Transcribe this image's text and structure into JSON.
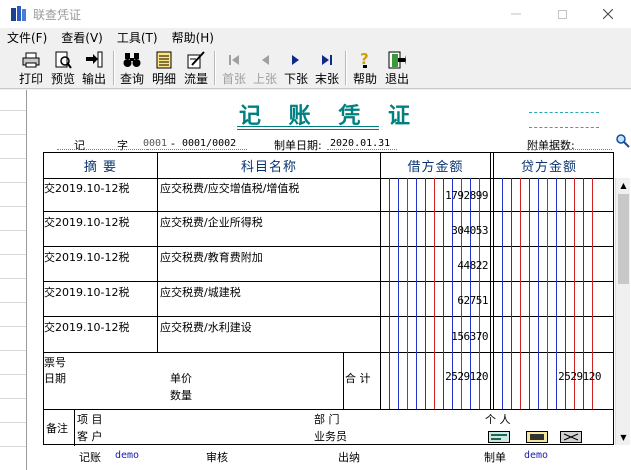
{
  "window": {
    "title": "联查凭证",
    "controls": [
      "minimize",
      "maximize",
      "close"
    ]
  },
  "menu": [
    "文件(F)",
    "查看(V)",
    "工具(T)",
    "帮助(H)"
  ],
  "toolbar": {
    "print": "打印",
    "preview": "预览",
    "export": "输出",
    "query": "查询",
    "detail": "明细",
    "flow": "流量",
    "first": "首张",
    "prev": "上张",
    "next": "下张",
    "last": "末张",
    "help": "帮助",
    "exit": "退出"
  },
  "voucher": {
    "title": "记 账 凭 证",
    "type_char": "记",
    "zi_label": "字",
    "number": "0001",
    "dash": "-",
    "page": "0001/0002",
    "date_label": "制单日期:",
    "date": "2020.01.31",
    "attachments_label": "附单据数:",
    "headers": {
      "summary": "摘  要",
      "account": "科目名称",
      "debit": "借方金额",
      "credit": "贷方金额"
    },
    "rows": [
      {
        "summary": "交2019.10-12税",
        "account": "应交税费/应交增值税/增值税",
        "debit": "1792899",
        "credit": ""
      },
      {
        "summary": "交2019.10-12税",
        "account": "应交税费/企业所得税",
        "debit": "304053",
        "credit": ""
      },
      {
        "summary": "交2019.10-12税",
        "account": "应交税费/教育费附加",
        "debit": "44822",
        "credit": ""
      },
      {
        "summary": "交2019.10-12税",
        "account": "应交税费/城建税",
        "debit": "62751",
        "credit": ""
      },
      {
        "summary": "交2019.10-12税",
        "account": "应交税费/水利建设",
        "debit": "156370",
        "credit": ""
      }
    ],
    "ticket_no_label": "票号",
    "ticket_date_label": "日期",
    "unit_price_label": "单价",
    "quantity_label": "数量",
    "total_label": "合  计",
    "total_debit": "2529120",
    "total_credit": "2529120",
    "memo_label": "备注",
    "project_label": "项  目",
    "customer_label": "客  户",
    "department_label": "部  门",
    "salesperson_label": "业务员",
    "individual_label": "个  人",
    "bookkeeper_label": "记账",
    "bookkeeper": "demo",
    "auditor_label": "审核",
    "cashier_label": "出纳",
    "preparer_label": "制单",
    "preparer": "demo"
  },
  "colors": {
    "title_teal": "#008080",
    "header_blue": "#0a3470",
    "digit_red": "#cc2222",
    "digit_blue": "#2233cc",
    "user_blue": "#1a1aa8"
  }
}
